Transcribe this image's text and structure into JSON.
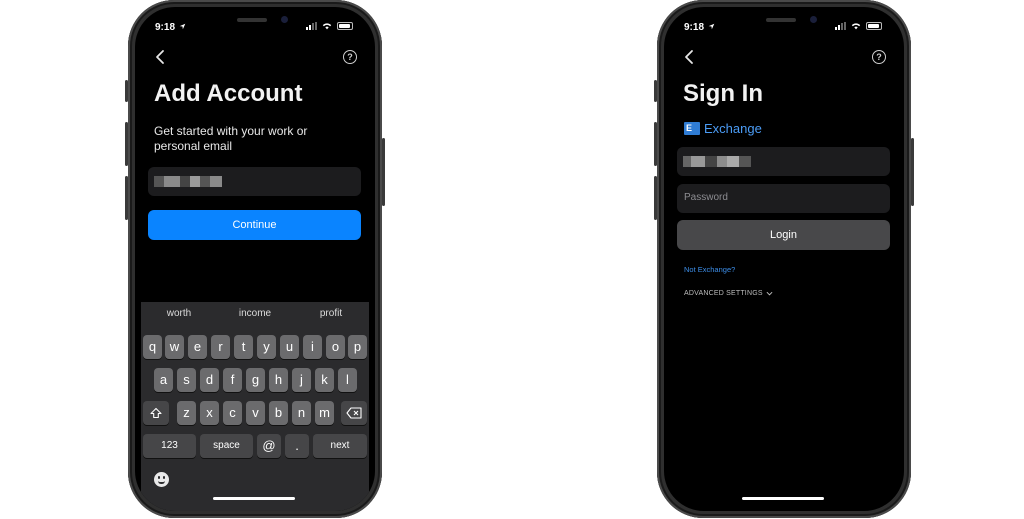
{
  "left_phone": {
    "status_time": "9:18",
    "title": "Add Account",
    "subtitle": "Get started with your work or personal email",
    "continue_label": "Continue",
    "suggestions": [
      "worth",
      "income",
      "profit"
    ],
    "keys_row1": [
      "q",
      "w",
      "e",
      "r",
      "t",
      "y",
      "u",
      "i",
      "o",
      "p"
    ],
    "keys_row2": [
      "a",
      "s",
      "d",
      "f",
      "g",
      "h",
      "j",
      "k",
      "l"
    ],
    "keys_row3": [
      "z",
      "x",
      "c",
      "v",
      "b",
      "n",
      "m"
    ],
    "key_numbers": "123",
    "key_space": "space",
    "key_at": "@",
    "key_dot": ".",
    "key_next": "next"
  },
  "right_phone": {
    "status_time": "9:18",
    "title": "Sign In",
    "provider_logo_letter": "E",
    "provider_name": "Exchange",
    "password_placeholder": "Password",
    "login_label": "Login",
    "not_exchange_link": "Not Exchange?",
    "advanced_settings": "ADVANCED SETTINGS"
  },
  "colors": {
    "accent_blue": "#0a84ff",
    "exchange_blue": "#2f7cd4",
    "screen_bg": "#000000",
    "field_bg": "#1c1c1e",
    "keyboard_bg": "#2b2b2d"
  },
  "icons": [
    "location-arrow-icon",
    "signal-icon",
    "wifi-icon",
    "battery-icon",
    "back-chevron-icon",
    "help-icon",
    "shift-icon",
    "delete-icon",
    "emoji-icon",
    "chevron-down-icon",
    "exchange-logo-icon"
  ]
}
